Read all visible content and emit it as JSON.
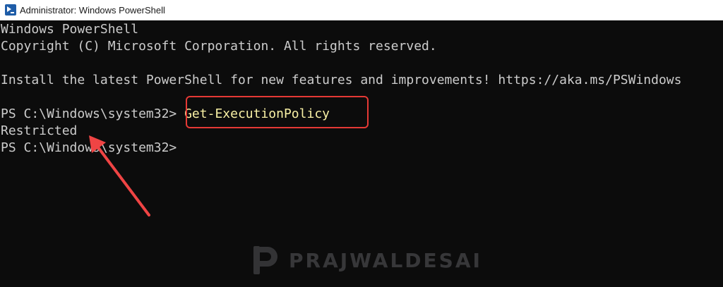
{
  "window": {
    "title": "Administrator: Windows PowerShell",
    "icon": "powershell-icon"
  },
  "console": {
    "lines": [
      "Windows PowerShell",
      "Copyright (C) Microsoft Corporation. All rights reserved.",
      "",
      "Install the latest PowerShell for new features and improvements! https://aka.ms/PSWindows",
      ""
    ],
    "prompt": "PS C:\\Windows\\system32> ",
    "command": "Get-ExecutionPolicy",
    "output": "Restricted",
    "next_prompt": "PS C:\\Windows\\system32>"
  },
  "annotations": {
    "box_color": "#e53935",
    "arrow_color": "#ef4444"
  },
  "watermark": {
    "text": "PRAJWALDESAI"
  },
  "colors": {
    "background": "#0c0c0c",
    "text": "#cccccc",
    "command": "#f9f1a5"
  }
}
